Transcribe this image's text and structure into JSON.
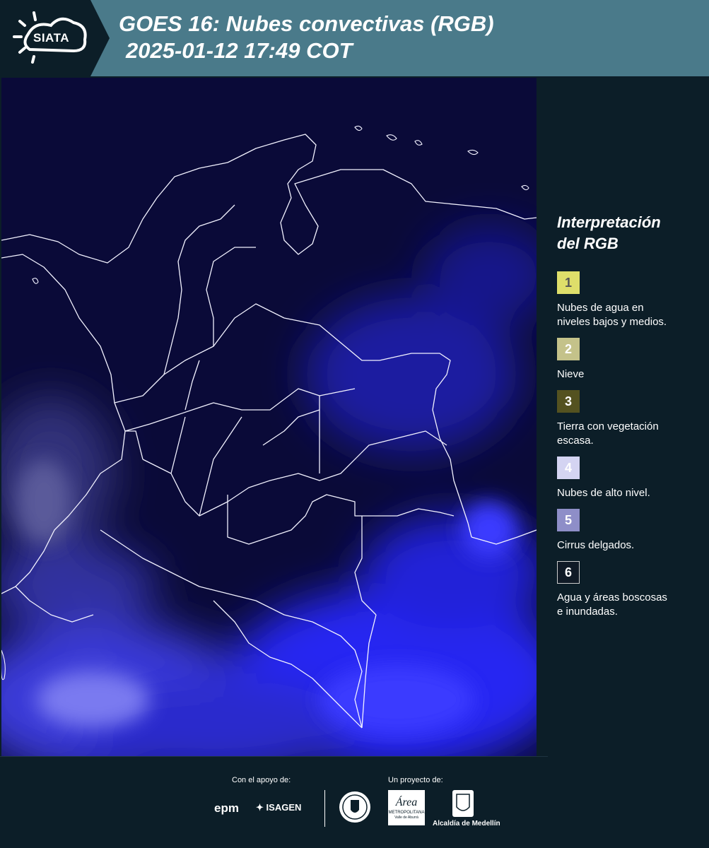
{
  "header": {
    "logo_text": "SIATA",
    "title_line1": "GOES 16: Nubes convectivas (RGB)",
    "title_line2": "2025-01-12 17:49 COT"
  },
  "map": {
    "icon": "satellite-map"
  },
  "legend": {
    "title_line1": "Interpretación",
    "title_line2": "del RGB",
    "items": [
      {
        "number": "1",
        "label_line1": "Nubes de agua en",
        "label_line2": "niveles bajos y medios.",
        "color": "#dede6a"
      },
      {
        "number": "2",
        "label_line1": "Nieve",
        "label_line2": "",
        "color": "#c4c28a"
      },
      {
        "number": "3",
        "label_line1": "Tierra con vegetación",
        "label_line2": "escasa.",
        "color": "#545220"
      },
      {
        "number": "4",
        "label_line1": "Nubes de alto nivel.",
        "label_line2": "",
        "color": "#d4d4f2"
      },
      {
        "number": "5",
        "label_line1": "Cirrus delgados.",
        "label_line2": "",
        "color": "#8e8ec8"
      },
      {
        "number": "6",
        "label_line1": "Agua y áreas boscosas",
        "label_line2": "e inundadas.",
        "color": "#101a26"
      }
    ]
  },
  "footer": {
    "support_label": "Con el apoyo de:",
    "project_label": "Un proyecto de:",
    "epm": "epm",
    "isagen": "ISAGEN",
    "area_line1": "Área",
    "area_line2": "METROPOLITANA",
    "area_line3": "Valle de Aburrá",
    "alcaldia": "Alcaldía de Medellín"
  }
}
